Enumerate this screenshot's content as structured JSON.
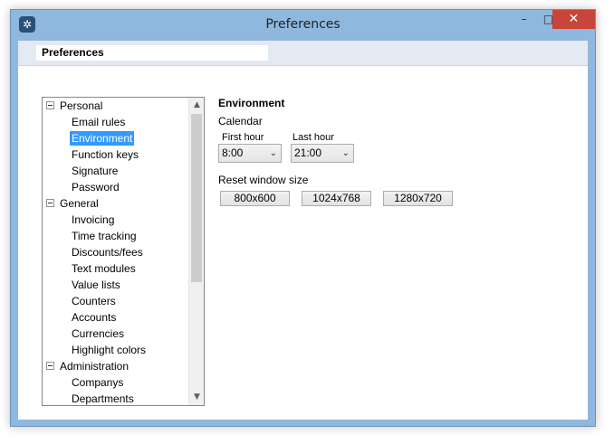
{
  "window": {
    "title": "Preferences",
    "icon": "app-logo-icon",
    "caption_buttons": {
      "minimize": "–",
      "maximize": "□",
      "close": "✕"
    }
  },
  "header": {
    "title": "Preferences"
  },
  "tree": {
    "items": [
      {
        "label": "Personal",
        "type": "group"
      },
      {
        "label": "Email rules",
        "type": "leaf"
      },
      {
        "label": "Environment",
        "type": "leaf",
        "selected": true
      },
      {
        "label": "Function keys",
        "type": "leaf"
      },
      {
        "label": "Signature",
        "type": "leaf"
      },
      {
        "label": "Password",
        "type": "leaf"
      },
      {
        "label": "General",
        "type": "group"
      },
      {
        "label": "Invoicing",
        "type": "leaf"
      },
      {
        "label": "Time tracking",
        "type": "leaf"
      },
      {
        "label": "Discounts/fees",
        "type": "leaf"
      },
      {
        "label": "Text modules",
        "type": "leaf"
      },
      {
        "label": "Value lists",
        "type": "leaf"
      },
      {
        "label": "Counters",
        "type": "leaf"
      },
      {
        "label": "Accounts",
        "type": "leaf"
      },
      {
        "label": "Currencies",
        "type": "leaf"
      },
      {
        "label": "Highlight colors",
        "type": "leaf"
      },
      {
        "label": "Administration",
        "type": "group"
      },
      {
        "label": "Companys",
        "type": "leaf"
      },
      {
        "label": "Departments",
        "type": "leaf"
      }
    ],
    "scroll_arrows": {
      "up": "▲",
      "down": "▼"
    }
  },
  "environment": {
    "title": "Environment",
    "calendar_label": "Calendar",
    "first_hour_label": "First hour",
    "first_hour_value": "8:00",
    "last_hour_label": "Last hour",
    "last_hour_value": "21:00",
    "reset_label": "Reset window size",
    "size_buttons": [
      "800x600",
      "1024x768",
      "1280x720"
    ]
  },
  "colors": {
    "selection": "#3399ff",
    "title_bar": "#8fb8de",
    "close_button": "#c7453b"
  }
}
